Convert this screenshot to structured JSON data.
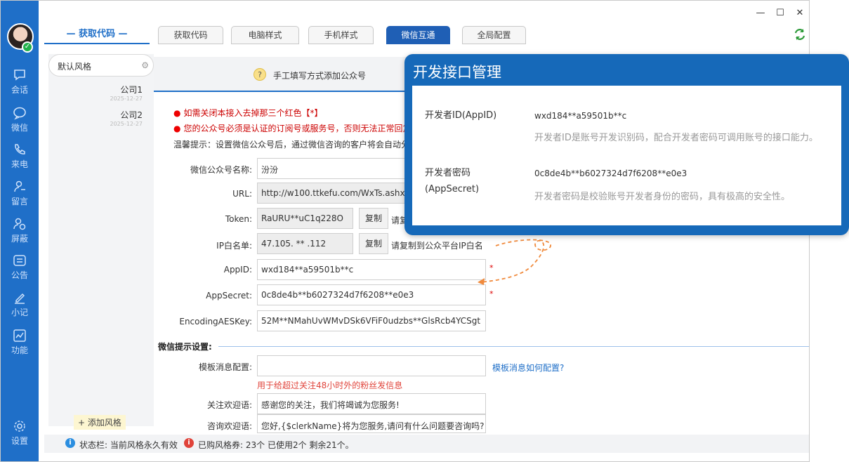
{
  "rail": {
    "items": [
      {
        "label": "会话",
        "icon": "chat-bubble-icon"
      },
      {
        "label": "微信",
        "icon": "wechat-bubble-icon"
      },
      {
        "label": "来电",
        "icon": "phone-icon"
      },
      {
        "label": "留言",
        "icon": "user-message-icon"
      },
      {
        "label": "屏蔽",
        "icon": "block-user-icon"
      },
      {
        "label": "公告",
        "icon": "announcement-icon"
      },
      {
        "label": "小记",
        "icon": "pen-icon"
      },
      {
        "label": "功能",
        "icon": "chart-icon"
      }
    ],
    "settings_label": "设置"
  },
  "style_panel": {
    "title": "— 获取代码 —",
    "default_style": "默认风格",
    "companies": [
      {
        "name": "公司1",
        "date": "2025-12-27"
      },
      {
        "name": "公司2",
        "date": "2025-12-27"
      }
    ],
    "add_label": "+ 添加风格"
  },
  "tabs": [
    {
      "label": "获取代码",
      "active": false
    },
    {
      "label": "电脑样式",
      "active": false
    },
    {
      "label": "手机样式",
      "active": false
    },
    {
      "label": "微信互通",
      "active": true
    },
    {
      "label": "全局配置",
      "active": false
    }
  ],
  "window_controls": {
    "minimize": "—",
    "maximize": "☐",
    "close": "✕"
  },
  "main": {
    "help_text": "手工填写方式添加公众号",
    "notice1": "如需关闭本接入去掉那三个红色【*】",
    "notice2": "您的公众号必须是认证的订阅号或服务号，否则无法正常回复",
    "tip": "温馨提示：设置微信公众号后，通过微信咨询的客户将会自动分",
    "fields": {
      "name_label": "微信公众号名称:",
      "name_value": "汾汾",
      "url_label": "URL:",
      "url_value": "http://w100.ttkefu.com/WxTs.ashx?r",
      "token_label": "Token:",
      "token_value": "RaURU**uC1q228O",
      "token_copy": "复制",
      "token_hint": "请复",
      "ip_label": "IP白名单:",
      "ip_value": "47.105. ** .112",
      "ip_copy": "复制",
      "ip_hint": "请复制到公众平台IP白名",
      "appid_label": "AppID:",
      "appid_value": "wxd184**a59501b**c",
      "secret_label": "AppSecret:",
      "secret_value": "0c8de4b**b6027324d7f6208**e0e3",
      "aes_label": "EncodingAESKey:",
      "aes_value": "52M**NMahUvWMvDSk6VFiF0udzbs**GlsRcb4YCSgt",
      "required_mark": "*"
    },
    "wechat_section": {
      "title": "微信提示设置:",
      "template_label": "模板消息配置:",
      "template_value": "",
      "template_link": "模板消息如何配置?",
      "template_note": "用于给超过关注48小时外的粉丝发信息",
      "follow_label": "关注欢迎语:",
      "follow_value": "感谢您的关注，我们将竭诚为您服务!",
      "consult_label": "咨询欢迎语:",
      "consult_value": "您好,{$clerkName}将为您服务,请问有什么问题要咨询吗?"
    }
  },
  "status_bar": {
    "label": "状态栏: 当前风格永久有效",
    "coupon": "已购风格券: 23个 已使用2个 剩余21个。"
  },
  "dev_card": {
    "title": "开发接口管理",
    "appid_label": "开发者ID(AppID)",
    "appid_value": "wxd184**a59501b**c",
    "appid_desc": "开发者ID是账号开发识别码，配合开发者密码可调用账号的接口能力。",
    "secret_label": "开发者密码(AppSecret)",
    "secret_value": "0c8de4b**b6027324d7f6208**e0e3",
    "secret_desc": "开发者密码是校验账号开发者身份的密码，具有极高的安全性。"
  },
  "colors": {
    "brand_blue": "#1f6fc8",
    "card_blue": "#1669b9",
    "warning_red": "#e0433a",
    "arrow_orange": "#f08a3c"
  }
}
